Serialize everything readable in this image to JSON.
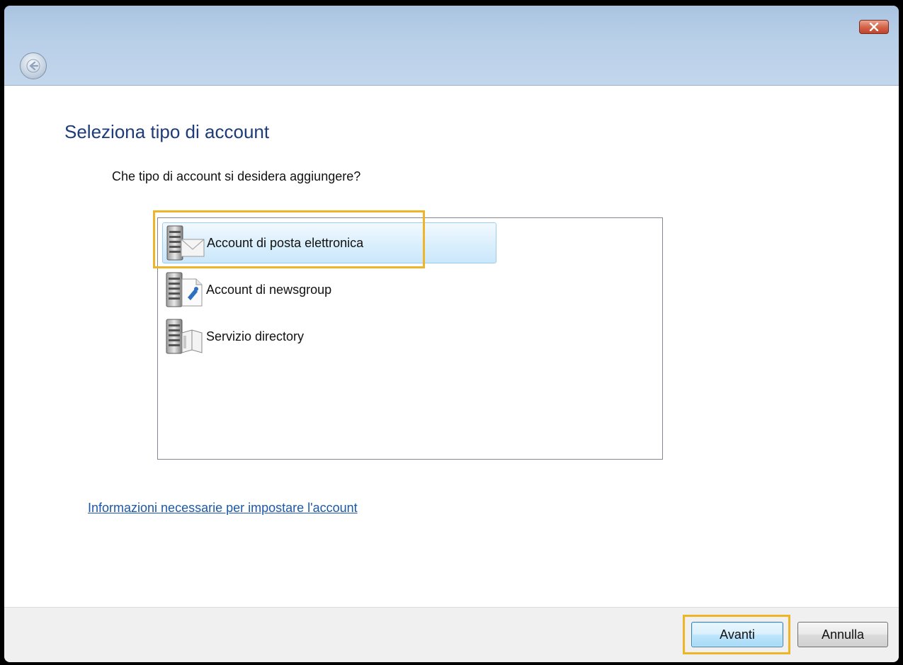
{
  "window": {
    "close_label": "✕"
  },
  "page": {
    "title": "Seleziona tipo di account",
    "question": "Che tipo di account si desidera aggiungere?"
  },
  "account_types": {
    "items": [
      {
        "label": "Account di posta elettronica",
        "icon": "mail-server-icon",
        "selected": true
      },
      {
        "label": "Account di newsgroup",
        "icon": "newsgroup-server-icon",
        "selected": false
      },
      {
        "label": "Servizio directory",
        "icon": "directory-server-icon",
        "selected": false
      }
    ]
  },
  "links": {
    "info": "Informazioni necessarie per impostare l'account"
  },
  "footer": {
    "next_label": "Avanti",
    "cancel_label": "Annulla"
  },
  "colors": {
    "highlight": "#f0b429",
    "title_blue": "#1e3b7a",
    "link_blue": "#1c58a9",
    "selection_bg": "#d8eefc"
  }
}
